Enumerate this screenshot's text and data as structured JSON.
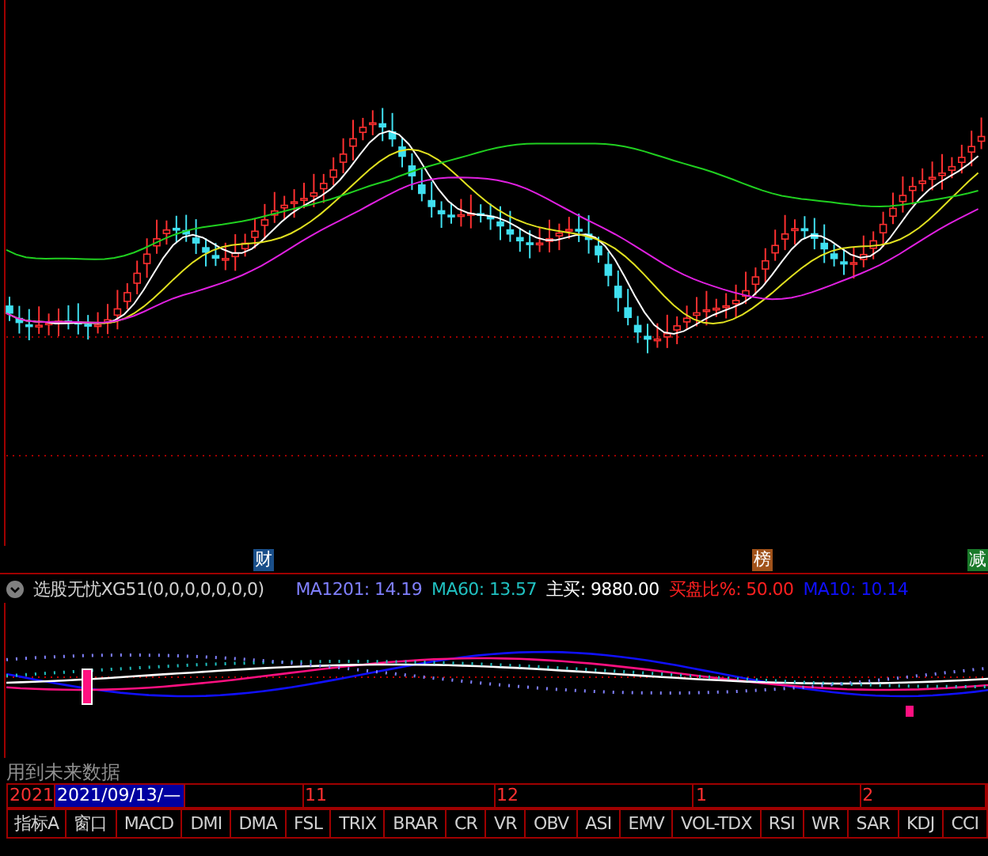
{
  "event_markers": [
    {
      "label": "财",
      "color": "#1a4f8a"
    },
    {
      "label": "榜",
      "color": "#a0521a"
    },
    {
      "label": "减",
      "color": "#1a7a2a"
    }
  ],
  "indicator_header": {
    "name": "选股无忧XG51(0,0,0,0,0,0,0)",
    "values": [
      {
        "text": "MA1201: 14.19",
        "color": "#8080ff"
      },
      {
        "text": "MA60: 13.57",
        "color": "#20c0c0"
      },
      {
        "text": "主买: 9880.00",
        "color": "#ffffff"
      },
      {
        "text": "买盘比%: 50.00",
        "color": "#ff2020"
      },
      {
        "text": "MA10: 10.14",
        "color": "#1010ff"
      }
    ]
  },
  "warning": "用到未来数据",
  "date_axis": [
    {
      "label": "2021",
      "selected": false
    },
    {
      "label": "2021/09/13/—",
      "selected": true
    },
    {
      "label": "11",
      "selected": false
    },
    {
      "label": "12",
      "selected": false
    },
    {
      "label": "1",
      "selected": false
    },
    {
      "label": "2",
      "selected": false
    }
  ],
  "indicator_tabs": [
    "指标A",
    "窗口",
    "MACD",
    "DMI",
    "DMA",
    "FSL",
    "TRIX",
    "BRAR",
    "CR",
    "VR",
    "OBV",
    "ASI",
    "EMV",
    "VOL-TDX",
    "RSI",
    "WR",
    "SAR",
    "KDJ",
    "CCI"
  ]
}
